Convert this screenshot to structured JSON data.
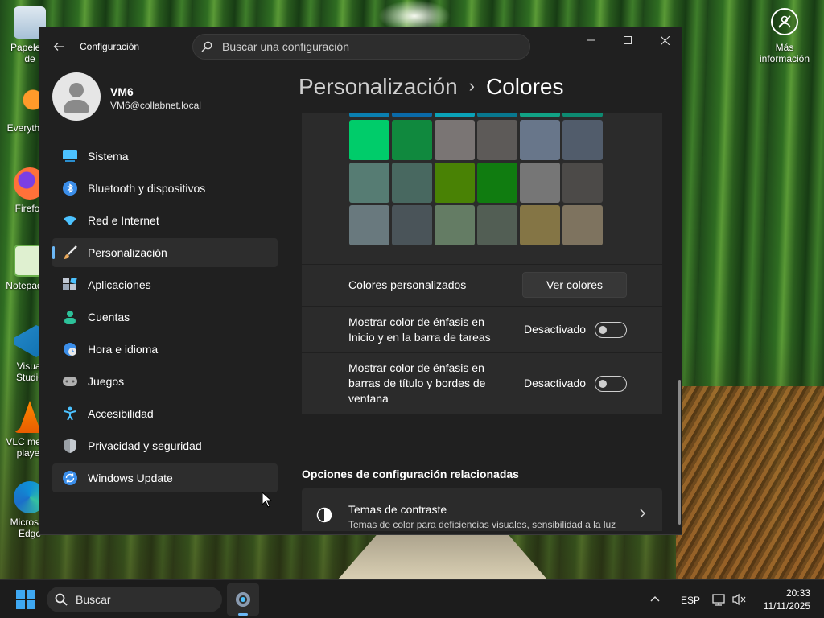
{
  "desktop": {
    "left_icons": [
      {
        "label": "Papelera de reciclaje",
        "icon": "recycle-bin-icon"
      },
      {
        "label": "Everything",
        "icon": "everything-icon"
      },
      {
        "label": "Firefox",
        "icon": "firefox-icon"
      },
      {
        "label": "Notepad++",
        "icon": "notepad-icon"
      },
      {
        "label": "Visual Studio Code",
        "icon": "vscode-icon"
      },
      {
        "label": "VLC media player",
        "icon": "vlc-icon"
      },
      {
        "label": "Microsoft Edge",
        "icon": "edge-icon"
      }
    ],
    "right_icon": {
      "label": "Más información",
      "icon": "info-circle-icon"
    }
  },
  "window": {
    "app_title": "Configuración",
    "search_placeholder": "Buscar una configuración"
  },
  "profile": {
    "name": "VM6",
    "email": "VM6@collabnet.local"
  },
  "nav": {
    "items": [
      {
        "label": "Sistema",
        "icon": "system-icon",
        "color": "#4cc2ff"
      },
      {
        "label": "Bluetooth y dispositivos",
        "icon": "bluetooth-icon",
        "color": "#3b8eea"
      },
      {
        "label": "Red e Internet",
        "icon": "wifi-icon",
        "color": "#4cc2ff"
      },
      {
        "label": "Personalización",
        "icon": "brush-icon",
        "color": "#e8a85c",
        "active": true
      },
      {
        "label": "Aplicaciones",
        "icon": "apps-icon",
        "color": "#9aa7b8"
      },
      {
        "label": "Cuentas",
        "icon": "person-icon",
        "color": "#2dc29a"
      },
      {
        "label": "Hora e idioma",
        "icon": "clock-globe-icon",
        "color": "#3b8eea"
      },
      {
        "label": "Juegos",
        "icon": "gamepad-icon",
        "color": "#b0b0b0"
      },
      {
        "label": "Accesibilidad",
        "icon": "accessibility-icon",
        "color": "#4cc2ff"
      },
      {
        "label": "Privacidad y seguridad",
        "icon": "shield-icon",
        "color": "#9aa0a6"
      },
      {
        "label": "Windows Update",
        "icon": "update-icon",
        "color": "#3b8eea"
      }
    ]
  },
  "header": {
    "crumb_parent": "Personalización",
    "separator": "›",
    "crumb_current": "Colores"
  },
  "colors": {
    "top_row": [
      "#0a7fb0",
      "#0a6aa8",
      "#0aa3b8",
      "#08788f",
      "#11a285",
      "#0d8a71"
    ],
    "grid": [
      [
        "#00cc6a",
        "#10893e",
        "#7a7574",
        "#5d5a58",
        "#68768a",
        "#515c6b"
      ],
      [
        "#567c73",
        "#486860",
        "#498205",
        "#107c10",
        "#767676",
        "#4c4a48"
      ],
      [
        "#69797e",
        "#4a5459",
        "#647c64",
        "#525e54",
        "#847545",
        "#7e735f"
      ]
    ]
  },
  "settings": {
    "custom_colors_label": "Colores personalizados",
    "custom_colors_button": "Ver colores",
    "accent_start_label": "Mostrar color de énfasis en Inicio y en la barra de tareas",
    "accent_start_state": "Desactivado",
    "accent_title_label": "Mostrar color de énfasis en barras de título y bordes de ventana",
    "accent_title_state": "Desactivado"
  },
  "related": {
    "title": "Opciones de configuración relacionadas",
    "contrast_title": "Temas de contraste",
    "contrast_subtitle": "Temas de color para deficiencias visuales, sensibilidad a la luz"
  },
  "taskbar": {
    "search_label": "Buscar",
    "language": "ESP",
    "time": "20:33",
    "date": "11/11/2025"
  }
}
